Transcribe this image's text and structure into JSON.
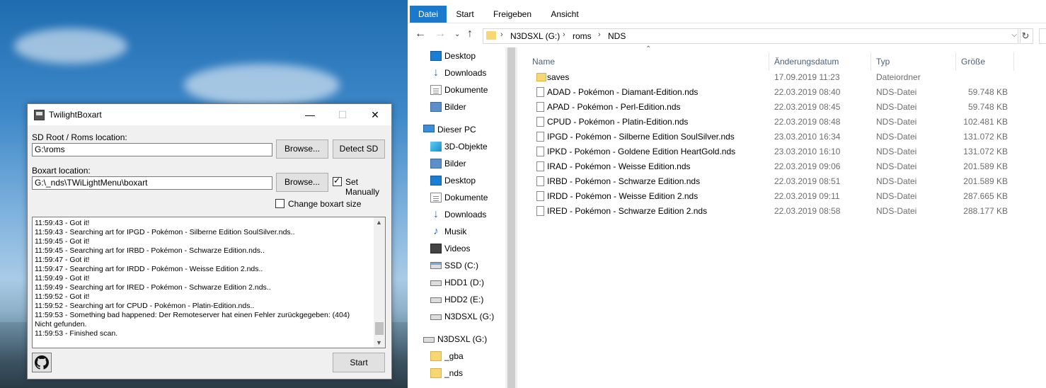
{
  "twilight": {
    "title": "TwilightBoxart",
    "sd_label": "SD Root / Roms location:",
    "sd_value": "G:\\roms",
    "browse_label": "Browse...",
    "detect_label": "Detect SD",
    "boxart_label": "Boxart location:",
    "boxart_value": "G:\\_nds\\TWiLightMenu\\boxart",
    "set_manually_label": "Set Manually",
    "set_manually_checked": true,
    "change_size_label": "Change boxart size",
    "change_size_checked": false,
    "start_label": "Start",
    "log": [
      "11:59:43 - Got it!",
      "11:59:43 - Searching art for IPGD - Pokémon - Silberne Edition SoulSilver.nds..",
      "11:59:45 - Got it!",
      "11:59:45 - Searching art for IRBD - Pokémon - Schwarze Edition.nds..",
      "11:59:47 - Got it!",
      "11:59:47 - Searching art for IRDD - Pokémon - Weisse Edition 2.nds..",
      "11:59:49 - Got it!",
      "11:59:49 - Searching art for IRED - Pokémon - Schwarze Edition 2.nds..",
      "11:59:52 - Got it!",
      "11:59:52 - Searching art for CPUD - Pokémon - Platin-Edition.nds..",
      "11:59:53 - Something bad happened: Der Remoteserver hat einen Fehler zurückgegeben: (404)",
      "Nicht gefunden.",
      "11:59:53 - Finished scan."
    ]
  },
  "explorer": {
    "tabs": [
      "Datei",
      "Start",
      "Freigeben",
      "Ansicht"
    ],
    "breadcrumb": [
      "N3DSXL (G:)",
      "roms",
      "NDS"
    ],
    "nav": [
      {
        "label": "Desktop",
        "icon": "desktop-icon",
        "pinned": true
      },
      {
        "label": "Downloads",
        "icon": "download-icon",
        "pinned": true
      },
      {
        "label": "Dokumente",
        "icon": "document-icon",
        "pinned": true
      },
      {
        "label": "Bilder",
        "icon": "pictures-icon",
        "pinned": true
      },
      {
        "label": "Dieser PC",
        "icon": "pc-icon",
        "pinned": false
      },
      {
        "label": "3D-Objekte",
        "icon": "3d-objects-icon",
        "pinned": false
      },
      {
        "label": "Bilder",
        "icon": "pictures-icon",
        "pinned": false
      },
      {
        "label": "Desktop",
        "icon": "desktop-icon",
        "pinned": false
      },
      {
        "label": "Dokumente",
        "icon": "document-icon",
        "pinned": false
      },
      {
        "label": "Downloads",
        "icon": "download-icon",
        "pinned": false
      },
      {
        "label": "Musik",
        "icon": "music-icon",
        "pinned": false
      },
      {
        "label": "Videos",
        "icon": "video-icon",
        "pinned": false
      },
      {
        "label": "SSD (C:)",
        "icon": "ssd-icon",
        "pinned": false
      },
      {
        "label": "HDD1 (D:)",
        "icon": "drive-icon",
        "pinned": false
      },
      {
        "label": "HDD2 (E:)",
        "icon": "drive-icon",
        "pinned": false
      },
      {
        "label": "N3DSXL (G:)",
        "icon": "drive-icon",
        "pinned": false
      },
      {
        "label": "N3DSXL (G:)",
        "icon": "drive-icon",
        "pinned": false
      },
      {
        "label": "_gba",
        "icon": "folder-icon",
        "pinned": false
      },
      {
        "label": "_nds",
        "icon": "folder-icon",
        "pinned": false
      }
    ],
    "columns": [
      "Name",
      "Änderungsdatum",
      "Typ",
      "Größe"
    ],
    "files": [
      {
        "name": "saves",
        "date": "17.09.2019 11:23",
        "type": "Dateiordner",
        "size": "",
        "folder": true
      },
      {
        "name": "ADAD - Pokémon - Diamant-Edition.nds",
        "date": "22.03.2019 08:40",
        "type": "NDS-Datei",
        "size": "59.748 KB",
        "folder": false
      },
      {
        "name": "APAD - Pokémon - Perl-Edition.nds",
        "date": "22.03.2019 08:45",
        "type": "NDS-Datei",
        "size": "59.748 KB",
        "folder": false
      },
      {
        "name": "CPUD - Pokémon - Platin-Edition.nds",
        "date": "22.03.2019 08:48",
        "type": "NDS-Datei",
        "size": "102.481 KB",
        "folder": false
      },
      {
        "name": "IPGD - Pokémon - Silberne Edition SoulSilver.nds",
        "date": "23.03.2010 16:34",
        "type": "NDS-Datei",
        "size": "131.072 KB",
        "folder": false
      },
      {
        "name": "IPKD - Pokémon - Goldene Edition HeartGold.nds",
        "date": "23.03.2010 16:10",
        "type": "NDS-Datei",
        "size": "131.072 KB",
        "folder": false
      },
      {
        "name": "IRAD - Pokémon - Weisse Edition.nds",
        "date": "22.03.2019 09:06",
        "type": "NDS-Datei",
        "size": "201.589 KB",
        "folder": false
      },
      {
        "name": "IRBD - Pokémon - Schwarze Edition.nds",
        "date": "22.03.2019 08:51",
        "type": "NDS-Datei",
        "size": "201.589 KB",
        "folder": false
      },
      {
        "name": "IRDD - Pokémon - Weisse Edition 2.nds",
        "date": "22.03.2019 09:11",
        "type": "NDS-Datei",
        "size": "287.665 KB",
        "folder": false
      },
      {
        "name": "IRED - Pokémon - Schwarze Edition 2.nds",
        "date": "22.03.2019 08:58",
        "type": "NDS-Datei",
        "size": "288.177 KB",
        "folder": false
      }
    ]
  }
}
